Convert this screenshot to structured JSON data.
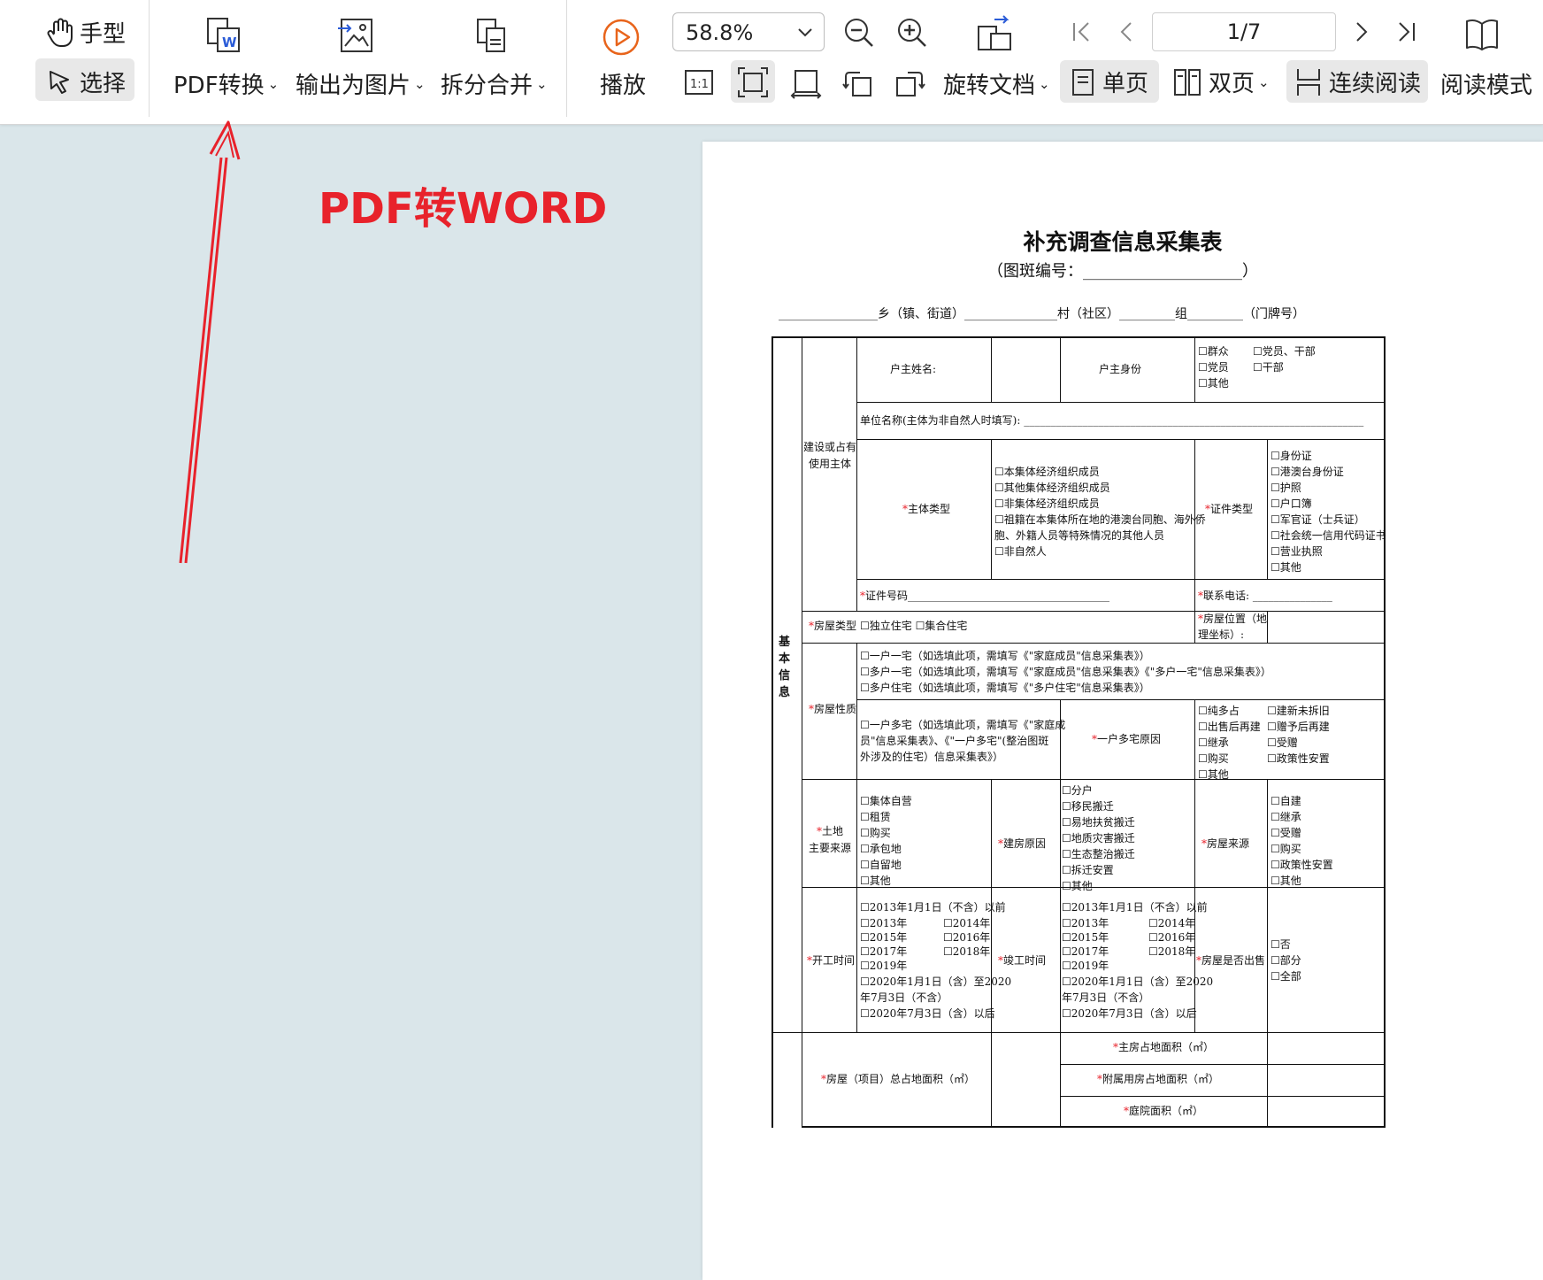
{
  "toolbar": {
    "hand_tool": "手型",
    "select_tool": "选择",
    "pdf_convert": "PDF转换",
    "export_image": "输出为图片",
    "split_merge": "拆分合并",
    "play": "播放",
    "zoom_value": "58.8%",
    "rotate_doc": "旋转文档",
    "single_page": "单页",
    "double_page": "双页",
    "continuous": "连续阅读",
    "reading_mode": "阅读模式",
    "page_indicator": "1/7",
    "actual_size_icon_text": "1:1"
  },
  "annotation": {
    "text": "PDF转WORD",
    "color": "#e8222b"
  },
  "document": {
    "title": "补充调查信息采集表",
    "subtitle": "（图斑编号：____________________）",
    "address_line": "________________乡（镇、街道）_______________村（社区）_________组_________（门牌号）",
    "section_basic": "基\n本\n信\n息",
    "cells": {
      "construction_subject": "建设或占有使用主体",
      "owner_name": "户主姓名:",
      "owner_identity": "户主身份",
      "identity_options": [
        "☐群众",
        "☐党员、干部",
        "☐党员",
        "☐干部",
        "☐其他"
      ],
      "unit_name": "单位名称(主体为非自然人时填写): ________________________________________________________________",
      "subject_type": "主体类型",
      "subject_options": [
        "☐本集体经济组织成员",
        "☐其他集体经济组织成员",
        "☐非集体经济组织成员",
        "☐祖籍在本集体所在地的港澳台同胞、海外侨",
        "胞、外籍人员等特殊情况的其他人员",
        "☐非自然人"
      ],
      "id_type": "证件类型",
      "id_options": [
        "☐身份证",
        "☐港澳台身份证",
        "☐护照",
        "☐户口簿",
        "☐军官证（士兵证）",
        "☐社会统一信用代码证书",
        "☐营业执照",
        "☐其他"
      ],
      "id_number": "证件号码______________________________________",
      "phone": "联系电话: _______________",
      "house_type": "房屋类型",
      "house_type_options": "☐独立住宅   ☐集合住宅",
      "house_location": [
        "房屋位置（地",
        "理坐标）:"
      ],
      "house_nature": "房屋性质",
      "nature_options": [
        "☐一户一宅（如选填此项，需填写《\"家庭成员\"信息采集表》）",
        "☐多户一宅（如选填此项，需填写《\"家庭成员\"信息采集表》《\"多户一宅\"信息采集表》）",
        "☐多户住宅（如选填此项，需填写《\"多户住宅\"信息采集表》）"
      ],
      "multi_house_opt": [
        "☐一户多宅（如选填此项，需填写《\"家庭成",
        "员\"信息采集表》、《\"一户多宅\"(整治图斑",
        "外涉及的住宅）信息采集表》）"
      ],
      "multi_house_reason": "一户多宅原因",
      "reason_options": [
        "☐纯多占",
        "☐建新未拆旧",
        "☐出售后再建",
        "☐赠予后再建",
        "☐继承",
        "☐受赠",
        "☐购买",
        "☐政策性安置",
        "☐其他"
      ],
      "land_source": [
        "土地",
        "主要来源"
      ],
      "land_options": [
        "☐集体自营",
        "☐租赁",
        "☐购买",
        "☐承包地",
        "☐自留地",
        "☐其他"
      ],
      "build_reason": "建房原因",
      "build_options": [
        "☐分户",
        "☐移民搬迁",
        "☐易地扶贫搬迁",
        "☐地质灾害搬迁",
        "☐生态整治搬迁",
        "☐拆迁安置",
        "☐其他"
      ],
      "house_source": "房屋来源",
      "house_source_options": [
        "☐自建",
        "☐继承",
        "☐受赠",
        "☐购买",
        "☐政策性安置",
        "☐其他"
      ],
      "start_time": "开工时间",
      "start_options": [
        "☐2013年1月1日（不含）以前",
        "☐2013年",
        "☐2014年",
        "☐2015年",
        "☐2016年",
        "☐2017年",
        "☐2018年",
        "☐2019年",
        "☐2020年1月1日（含）至2020",
        "年7月3日（不含）",
        "☐2020年7月3日（含）以后"
      ],
      "end_time": "竣工时间",
      "sold": "房屋是否出售",
      "sold_options": [
        "☐否",
        "☐部分",
        "☐全部"
      ],
      "total_area": "房屋（项目）总占地面积（㎡）",
      "main_area": "主房占地面积（㎡）",
      "aux_area": "附属用房占地面积（㎡）",
      "yard_area": "庭院面积（㎡）"
    }
  }
}
